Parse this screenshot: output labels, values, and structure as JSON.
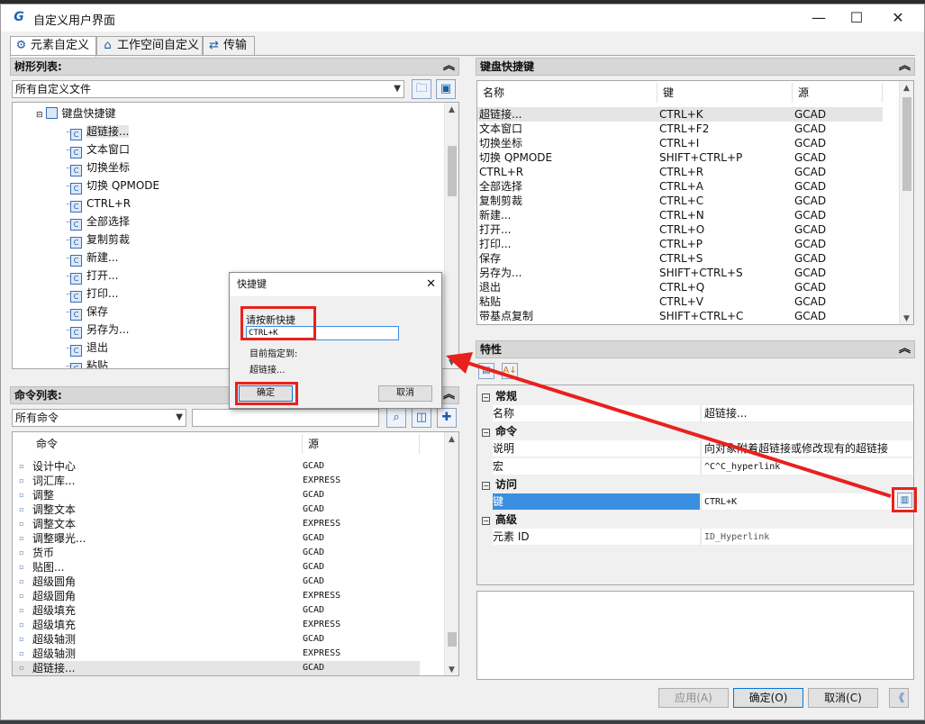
{
  "window": {
    "title": "自定义用户界面",
    "logo": "G",
    "minimize": "—",
    "maximize": "☐",
    "close": "✕"
  },
  "tabs": [
    {
      "label": "元素自定义",
      "icon": "gear-icon"
    },
    {
      "label": "工作空间自定义",
      "icon": "home-icon"
    },
    {
      "label": "传输",
      "icon": "transfer-icon"
    }
  ],
  "tree_panel": {
    "header": "树形列表:",
    "filter_value": "所有自定义文件",
    "root": "键盘快捷键",
    "items": [
      "超链接...",
      "文本窗口",
      "切换坐标",
      "切换 QPMODE",
      "CTRL+R",
      "全部选择",
      "复制剪裁",
      "新建...",
      "打开...",
      "打印...",
      "保存",
      "另存为...",
      "退出",
      "粘贴"
    ]
  },
  "command_panel": {
    "header": "命令列表:",
    "filter_value": "所有命令",
    "search_value": "",
    "col_command": "命令",
    "col_source": "源",
    "rows": [
      {
        "name": "设计中心",
        "source": "GCAD"
      },
      {
        "name": "词汇库...",
        "source": "EXPRESS"
      },
      {
        "name": "调整",
        "source": "GCAD"
      },
      {
        "name": "调整文本",
        "source": "GCAD"
      },
      {
        "name": "调整文本",
        "source": "EXPRESS"
      },
      {
        "name": "调整曝光...",
        "source": "GCAD"
      },
      {
        "name": "货币",
        "source": "GCAD"
      },
      {
        "name": "贴图...",
        "source": "GCAD"
      },
      {
        "name": "超级圆角",
        "source": "GCAD"
      },
      {
        "name": "超级圆角",
        "source": "EXPRESS"
      },
      {
        "name": "超级填充",
        "source": "GCAD"
      },
      {
        "name": "超级填充",
        "source": "EXPRESS"
      },
      {
        "name": "超级轴测",
        "source": "GCAD"
      },
      {
        "name": "超级轴测",
        "source": "EXPRESS"
      },
      {
        "name": "超链接...",
        "source": "GCAD"
      }
    ]
  },
  "shortcut_panel": {
    "header": "键盘快捷键",
    "col_name": "名称",
    "col_key": "键",
    "col_source": "源",
    "rows": [
      {
        "name": "超链接...",
        "key": "CTRL+K",
        "source": "GCAD"
      },
      {
        "name": "文本窗口",
        "key": "CTRL+F2",
        "source": "GCAD"
      },
      {
        "name": "切换坐标",
        "key": "CTRL+I",
        "source": "GCAD"
      },
      {
        "name": "切换 QPMODE",
        "key": "SHIFT+CTRL+P",
        "source": "GCAD"
      },
      {
        "name": "CTRL+R",
        "key": "CTRL+R",
        "source": "GCAD"
      },
      {
        "name": "全部选择",
        "key": "CTRL+A",
        "source": "GCAD"
      },
      {
        "name": "复制剪裁",
        "key": "CTRL+C",
        "source": "GCAD"
      },
      {
        "name": "新建...",
        "key": "CTRL+N",
        "source": "GCAD"
      },
      {
        "name": "打开...",
        "key": "CTRL+O",
        "source": "GCAD"
      },
      {
        "name": "打印...",
        "key": "CTRL+P",
        "source": "GCAD"
      },
      {
        "name": "保存",
        "key": "CTRL+S",
        "source": "GCAD"
      },
      {
        "name": "另存为...",
        "key": "SHIFT+CTRL+S",
        "source": "GCAD"
      },
      {
        "name": "退出",
        "key": "CTRL+Q",
        "source": "GCAD"
      },
      {
        "name": "粘贴",
        "key": "CTRL+V",
        "source": "GCAD"
      },
      {
        "name": "带基点复制",
        "key": "SHIFT+CTRL+C",
        "source": "GCAD"
      }
    ]
  },
  "properties_panel": {
    "header": "特性",
    "sections": {
      "general": "常规",
      "command": "命令",
      "access": "访问",
      "advanced": "高级"
    },
    "rows": {
      "name_key": "名称",
      "name_value": "超链接...",
      "desc_key": "说明",
      "desc_value": "向对象附着超链接或修改现有的超链接",
      "macro_key": "宏",
      "macro_value": "^C^C_hyperlink",
      "key_key": "键",
      "key_value": "CTRL+K",
      "id_key": "元素 ID",
      "id_value": "ID_Hyperlink"
    }
  },
  "dialog": {
    "title": "快捷键",
    "prompt": "请按新快捷",
    "input_value": "CTRL+K",
    "assigned_label": "目前指定到:",
    "assigned_value": "超链接...",
    "ok": "确定",
    "cancel": "取消"
  },
  "footer": {
    "apply": "应用(A)",
    "ok": "确定(O)",
    "cancel": "取消(C)",
    "collapse": "《"
  },
  "colors": {
    "highlight": "#e8211d",
    "selection_blue": "#3b8fe0"
  }
}
